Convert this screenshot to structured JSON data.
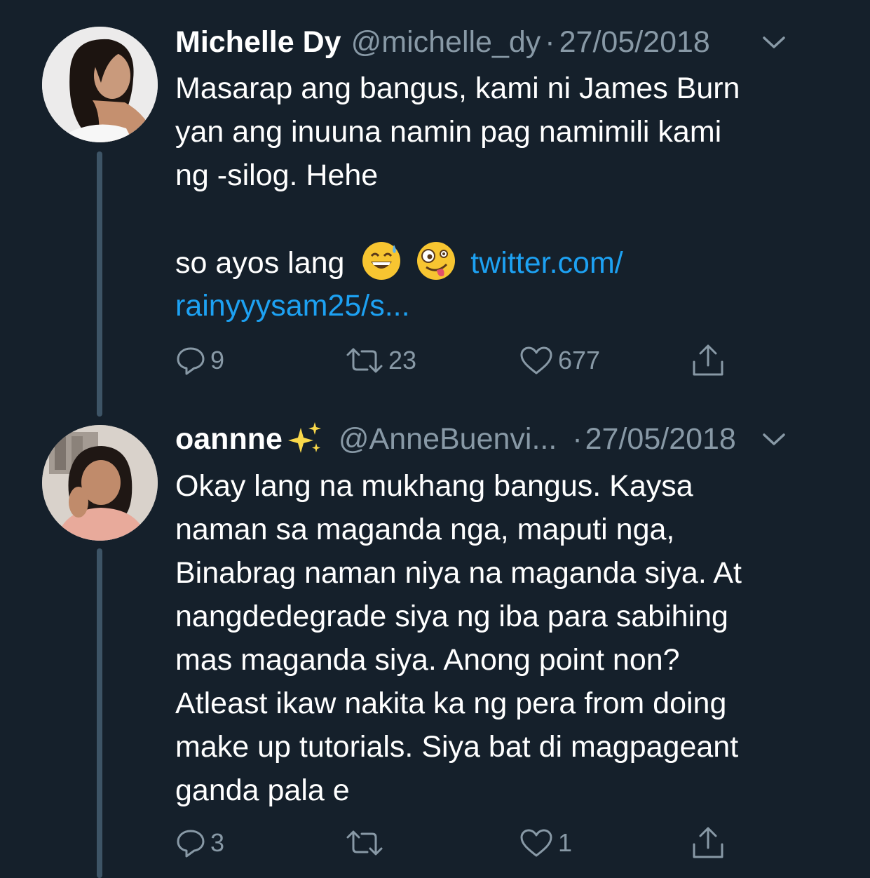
{
  "tweets": [
    {
      "name": "Michelle Dy",
      "handle": "@michelle_dy",
      "separator": "·",
      "date": "27/05/2018",
      "avatar_icon": "avatar-photo-woman",
      "lines": [
        "Masarap ang bangus, kami ni James Burn",
        "yan ang inuuna namin pag namimili kami",
        "ng -silog. Hehe"
      ],
      "line_after_blank": "so ayos lang",
      "emojis": [
        "grinning-sweat-emoji",
        "zany-face-emoji"
      ],
      "link_part1": "twitter.com/",
      "link_part2": "rainyyysam25/s...",
      "replies": "9",
      "retweets": "23",
      "likes": "677"
    },
    {
      "name": "oannne",
      "name_emoji": "sparkles-icon",
      "handle": "@AnneBuenvi...",
      "separator": "·",
      "date": "27/05/2018",
      "avatar_icon": "avatar-photo-girl",
      "lines": [
        "Okay lang na mukhang bangus. Kaysa",
        "naman sa maganda nga, maputi nga,",
        "Binabrag naman niya na maganda siya. At",
        "nangdedegrade siya ng iba para sabihing",
        "mas maganda siya. Anong point non?",
        "Atleast ikaw nakita ka ng pera from doing",
        "make up tutorials. Siya bat di magpageant",
        "ganda pala e"
      ],
      "replies": "3",
      "retweets": "",
      "likes": "1"
    }
  ],
  "colors": {
    "background": "#15202b",
    "text": "#ffffff",
    "secondary": "#8899a6",
    "link": "#1da1f2",
    "thread_line": "#3d5466"
  },
  "icons": {
    "reply": "reply-icon",
    "retweet": "retweet-icon",
    "like": "heart-icon",
    "share": "share-icon",
    "menu": "chevron-down-icon"
  }
}
